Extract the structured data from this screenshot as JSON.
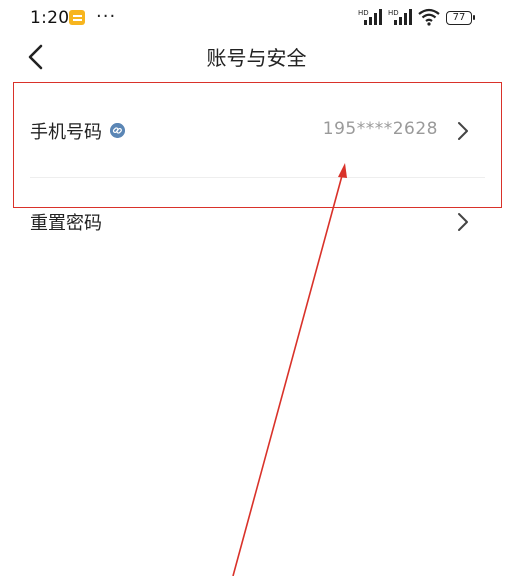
{
  "status_bar": {
    "time": "1:20",
    "more": "···",
    "battery": "77"
  },
  "header": {
    "title": "账号与安全"
  },
  "rows": [
    {
      "label": "手机号码",
      "value": "195****2628"
    },
    {
      "label": "重置密码"
    }
  ],
  "icons": {
    "back": "back-arrow-icon",
    "phone_linked": "link-icon",
    "chevron": "chevron-right-icon"
  },
  "colors": {
    "annotation": "#d9322a",
    "value_text": "#9a9a9a",
    "link_icon": "#5b86b5"
  }
}
